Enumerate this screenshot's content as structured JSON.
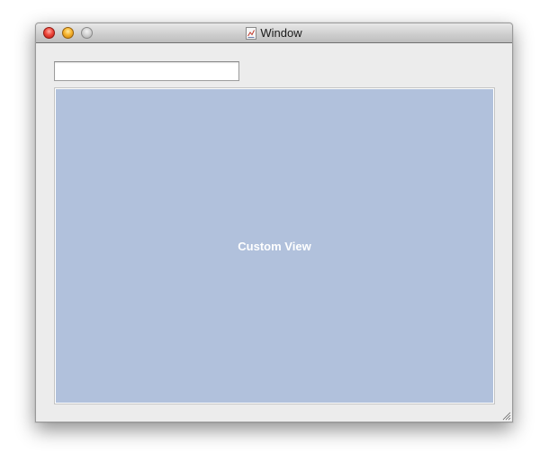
{
  "window": {
    "title": "Window",
    "icons": {
      "close": "close-icon",
      "minimize": "minimize-icon",
      "zoom": "zoom-icon",
      "document": "document-icon",
      "resize": "resize-grip-icon"
    }
  },
  "content": {
    "text_field": {
      "value": "",
      "placeholder": ""
    },
    "custom_view": {
      "label": "Custom View",
      "background_color": "#b1c1dc"
    }
  }
}
